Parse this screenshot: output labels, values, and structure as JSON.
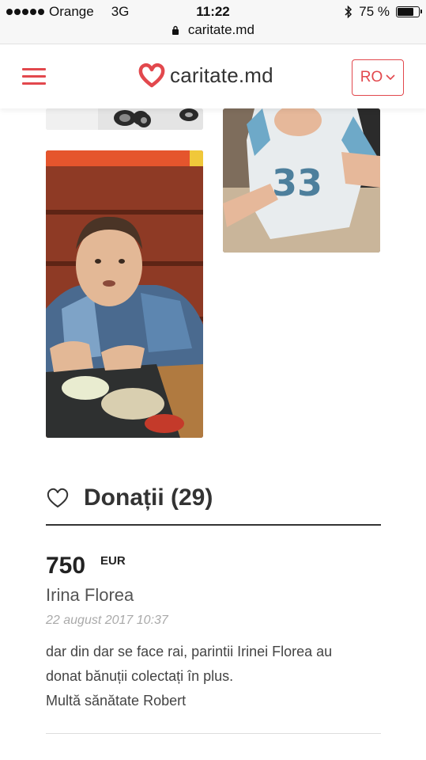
{
  "status_bar": {
    "carrier": "Orange",
    "network": "3G",
    "time": "11:22",
    "battery": "75 %",
    "battery_level": 0.75
  },
  "browser": {
    "url": "caritate.md"
  },
  "header": {
    "logo_text": "caritate.md",
    "language": "RO",
    "accent_color": "#e2484d"
  },
  "donations": {
    "title": "Donații (29)",
    "items": [
      {
        "amount": "750",
        "currency": "EUR",
        "donor": "Irina Florea",
        "date": "22 august 2017 10:37",
        "message": "dar din dar se face rai, parintii Irinei Florea au\ndonat bănuții colectați în plus.\nMultă sănătate Robert"
      }
    ]
  }
}
